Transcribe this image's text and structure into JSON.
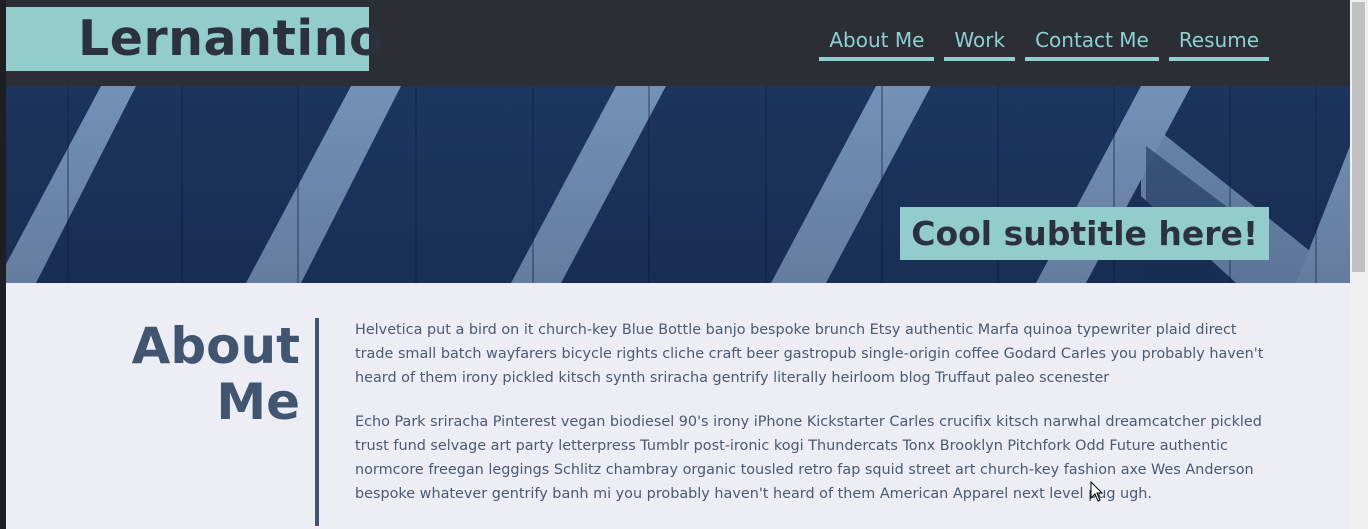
{
  "header": {
    "logo": "Lernantino",
    "nav": [
      {
        "label": "About Me"
      },
      {
        "label": "Work"
      },
      {
        "label": "Contact Me"
      },
      {
        "label": "Resume"
      }
    ]
  },
  "hero": {
    "subtitle": "Cool subtitle here!"
  },
  "about": {
    "title_line1": "About",
    "title_line2": "Me",
    "paragraphs": [
      "Helvetica put a bird on it church-key Blue Bottle banjo bespoke brunch Etsy authentic Marfa quinoa typewriter plaid direct trade small batch wayfarers bicycle rights cliche craft beer gastropub single-origin coffee Godard Carles you probably haven't heard of them irony pickled kitsch synth sriracha gentrify literally heirloom blog Truffaut paleo scenester",
      "Echo Park sriracha Pinterest vegan biodiesel 90's irony iPhone Kickstarter Carles crucifix kitsch narwhal dreamcatcher pickled trust fund selvage art party letterpress Tumblr post-ironic kogi Thundercats Tonx Brooklyn Pitchfork Odd Future authentic normcore freegan leggings Schlitz chambray organic tousled retro fap squid street art church-key fashion axe Wes Anderson bespoke whatever gentrify banh mi you probably haven't heard of them American Apparel next level pug ugh."
    ]
  },
  "colors": {
    "header_bg": "#2c2e36",
    "accent": "#92cccc",
    "heading": "#415570",
    "page_bg": "#ecedf5",
    "stripe_dark": "#1d3763",
    "stripe_light": "#7a98c1"
  }
}
